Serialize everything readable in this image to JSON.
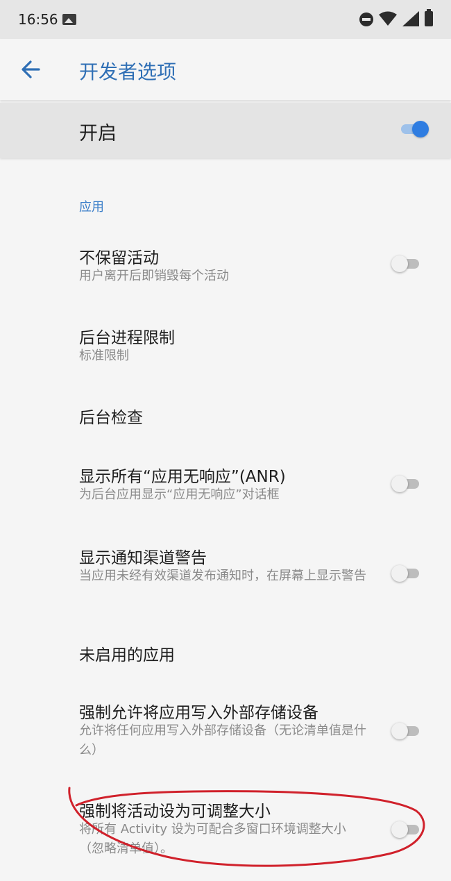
{
  "status_bar": {
    "time": "16:56",
    "icons": [
      "image-icon",
      "do-not-disturb-icon",
      "wifi-icon",
      "signal-icon",
      "battery-icon"
    ]
  },
  "app_bar": {
    "title": "开发者选项",
    "back_icon": "arrow-left-icon"
  },
  "master_switch": {
    "label": "开启",
    "on": true
  },
  "section": {
    "title": "应用"
  },
  "items": [
    {
      "title": "不保留活动",
      "summary": "用户离开后即销毁每个活动",
      "has_switch": true,
      "on": false
    },
    {
      "title": "后台进程限制",
      "summary": "标准限制",
      "has_switch": false
    },
    {
      "title": "后台检查",
      "summary": "",
      "has_switch": false
    },
    {
      "title": "显示所有“应用无响应”(ANR)",
      "summary": "为后台应用显示“应用无响应”对话框",
      "has_switch": true,
      "on": false
    },
    {
      "title": "显示通知渠道警告",
      "summary": "当应用未经有效渠道发布通知时，在屏幕上显示警告",
      "has_switch": true,
      "on": false
    },
    {
      "title": "未启用的应用",
      "summary": "",
      "has_switch": false
    },
    {
      "title": "强制允许将应用写入外部存储设备",
      "summary": "允许将任何应用写入外部存储设备（无论清单值是什么）",
      "has_switch": true,
      "on": false
    },
    {
      "title": "强制将活动设为可调整大小",
      "summary": "将所有 Activity 设为可配合多窗口环境调整大小（忽略清单值）。",
      "has_switch": true,
      "on": false
    }
  ],
  "colors": {
    "accent": "#2f7de1",
    "title_blue": "#2f6fb5",
    "annotation_red": "#d0212b"
  }
}
